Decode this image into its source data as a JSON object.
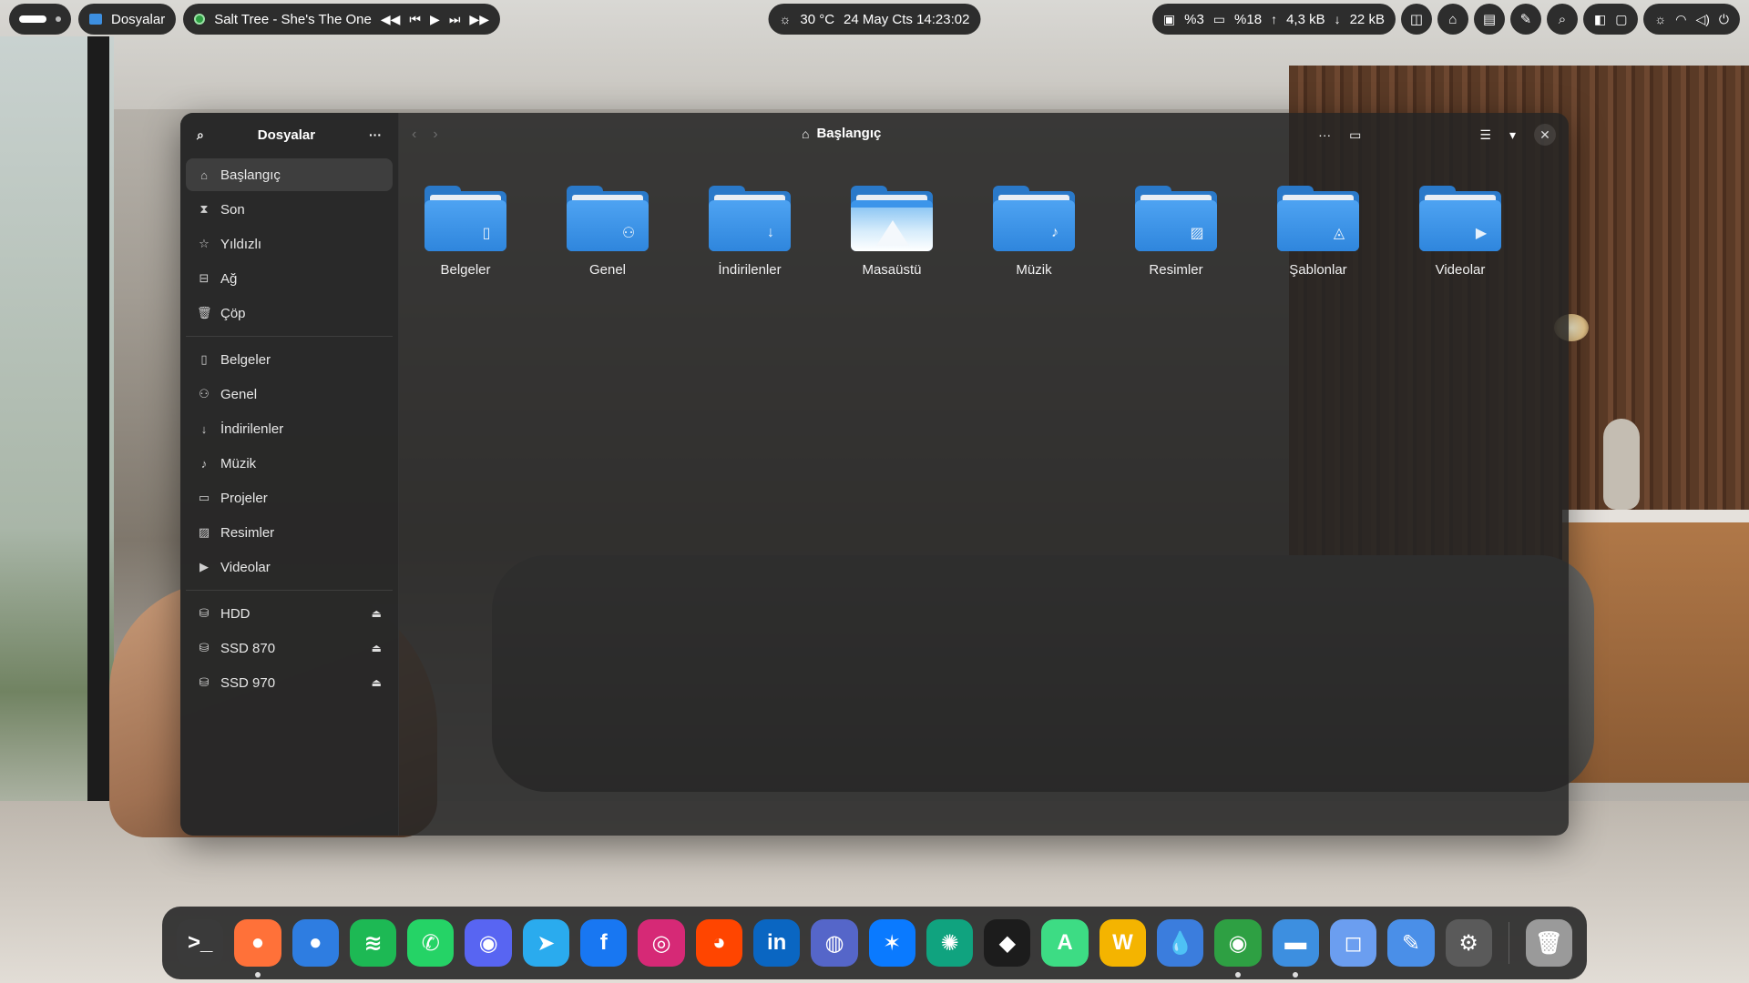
{
  "topbar": {
    "app_name": "Dosyalar",
    "media_title": "Salt Tree - She's The One",
    "weather": "30 °C",
    "datetime": "24 May Cts 14:23:02",
    "cpu": "%3",
    "ram": "%18",
    "upload": "4,3 kB",
    "download": "22 kB"
  },
  "window": {
    "sidebar_title": "Dosyalar",
    "path": "Başlangıç",
    "places": [
      {
        "label": "Başlangıç",
        "icon": "home-icon"
      },
      {
        "label": "Son",
        "icon": "clock-icon"
      },
      {
        "label": "Yıldızlı",
        "icon": "star-icon"
      },
      {
        "label": "Ağ",
        "icon": "network-icon"
      },
      {
        "label": "Çöp",
        "icon": "trash-icon"
      }
    ],
    "bookmarks": [
      {
        "label": "Belgeler",
        "icon": "document-icon"
      },
      {
        "label": "Genel",
        "icon": "users-icon"
      },
      {
        "label": "İndirilenler",
        "icon": "download-icon"
      },
      {
        "label": "Müzik",
        "icon": "music-icon"
      },
      {
        "label": "Projeler",
        "icon": "folder-icon"
      },
      {
        "label": "Resimler",
        "icon": "image-icon"
      },
      {
        "label": "Videolar",
        "icon": "video-icon"
      }
    ],
    "drives": [
      {
        "label": "HDD"
      },
      {
        "label": "SSD 870"
      },
      {
        "label": "SSD 970"
      }
    ],
    "folders": [
      {
        "label": "Belgeler",
        "emblem": "document-icon"
      },
      {
        "label": "Genel",
        "emblem": "users-icon"
      },
      {
        "label": "İndirilenler",
        "emblem": "download-icon"
      },
      {
        "label": "Masaüstü",
        "emblem": "desktop-icon"
      },
      {
        "label": "Müzik",
        "emblem": "music-icon"
      },
      {
        "label": "Resimler",
        "emblem": "image-icon"
      },
      {
        "label": "Şablonlar",
        "emblem": "template-icon"
      },
      {
        "label": "Videolar",
        "emblem": "video-icon"
      }
    ]
  },
  "dock": {
    "apps": [
      {
        "name": "terminal-icon",
        "color": "#3a3a3a",
        "glyph": ">_"
      },
      {
        "name": "firefox-icon",
        "color": "#ff7139",
        "glyph": "●"
      },
      {
        "name": "thunderbird-icon",
        "color": "#2e7de1",
        "glyph": "●"
      },
      {
        "name": "spotify-icon",
        "color": "#1db954",
        "glyph": "≋"
      },
      {
        "name": "whatsapp-icon",
        "color": "#25d366",
        "glyph": "✆"
      },
      {
        "name": "discord-icon",
        "color": "#5865f2",
        "glyph": "◉"
      },
      {
        "name": "telegram-icon",
        "color": "#2aabee",
        "glyph": "➤"
      },
      {
        "name": "facebook-icon",
        "color": "#1877f2",
        "glyph": "f"
      },
      {
        "name": "instagram-icon",
        "color": "#d62976",
        "glyph": "◎"
      },
      {
        "name": "reddit-icon",
        "color": "#ff4500",
        "glyph": "◕"
      },
      {
        "name": "linkedin-icon",
        "color": "#0a66c2",
        "glyph": "in"
      },
      {
        "name": "signal-icon",
        "color": "#5566c9",
        "glyph": "◍"
      },
      {
        "name": "bluesky-icon",
        "color": "#0a7aff",
        "glyph": "✶"
      },
      {
        "name": "chatgpt-icon",
        "color": "#10a37f",
        "glyph": "✺"
      },
      {
        "name": "box-icon",
        "color": "#1c1c1c",
        "glyph": "◆"
      },
      {
        "name": "android-studio-icon",
        "color": "#3ddc84",
        "glyph": "A"
      },
      {
        "name": "android-icon",
        "color": "#f4b400",
        "glyph": "W"
      },
      {
        "name": "droplet-icon",
        "color": "#3b7ddd",
        "glyph": "💧"
      },
      {
        "name": "music-player-icon",
        "color": "#2ea043",
        "glyph": "◉"
      },
      {
        "name": "files-icon",
        "color": "#3d8fe0",
        "glyph": "▬"
      },
      {
        "name": "software-icon",
        "color": "#6b9ef0",
        "glyph": "◻"
      },
      {
        "name": "text-editor-icon",
        "color": "#4a8fe8",
        "glyph": "✎"
      },
      {
        "name": "settings-icon",
        "color": "#5a5a5a",
        "glyph": "⚙"
      },
      {
        "name": "trash-icon",
        "color": "#9a9a9a",
        "glyph": "🗑"
      }
    ]
  }
}
